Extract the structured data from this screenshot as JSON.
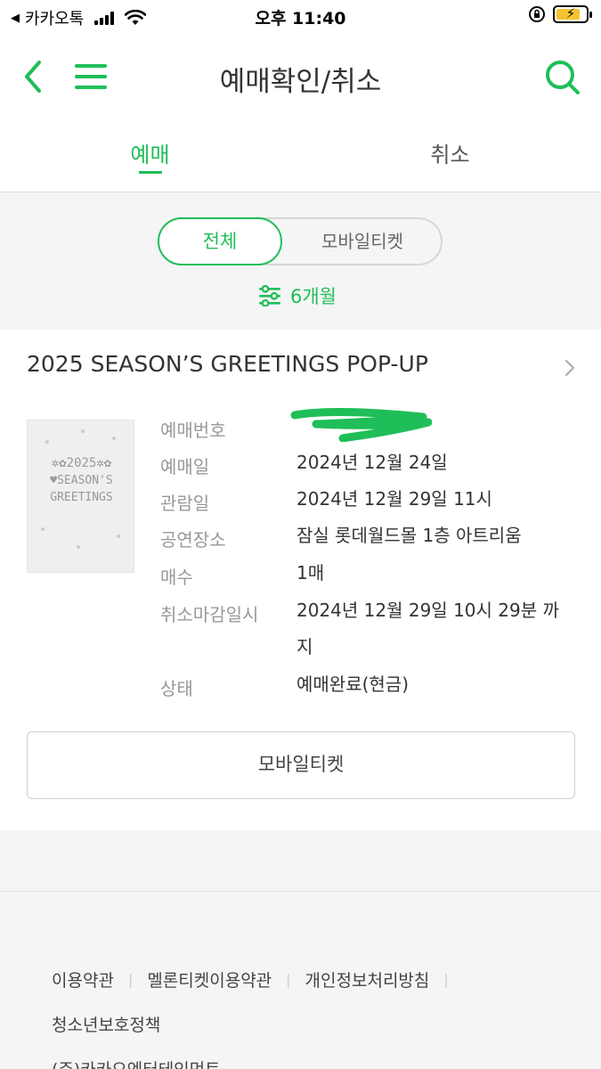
{
  "status_bar": {
    "carrier": "카카오톡",
    "time": "오후 11:40"
  },
  "header": {
    "title": "예매확인/취소"
  },
  "tabs": [
    {
      "label": "예매"
    },
    {
      "label": "취소"
    }
  ],
  "filter": {
    "segments": [
      {
        "label": "전체"
      },
      {
        "label": "모바일티켓"
      }
    ],
    "period": "6개월"
  },
  "booking": {
    "event_title": "2025 SEASON’S GREETINGS POP-UP",
    "poster_text": [
      "✲✿2025✲✿",
      "♥SEASON'S",
      "GREETINGS"
    ],
    "fields": [
      {
        "label": "예매번호",
        "value": ""
      },
      {
        "label": "예매일",
        "value": "2024년 12월 24일"
      },
      {
        "label": "관람일",
        "value": "2024년 12월 29일 11시"
      },
      {
        "label": "공연장소",
        "value": "잠실 롯데월드몰 1층 아트리움"
      },
      {
        "label": "매수",
        "value": "1매"
      },
      {
        "label": "취소마감일시",
        "value": "2024년 12월 29일 10시 29분 까지"
      },
      {
        "label": "상태",
        "value": "예매완료(현금)"
      }
    ],
    "mobile_ticket_button": "모바일티켓"
  },
  "footer": {
    "links": [
      "이용약관",
      "멜론티켓이용약관",
      "개인정보처리방침"
    ],
    "links_row2": "청소년보호정책",
    "company": "(주)카카오엔터테인먼트"
  },
  "colors": {
    "accent": "#1fbe58",
    "redaction": "#1fbe58"
  }
}
